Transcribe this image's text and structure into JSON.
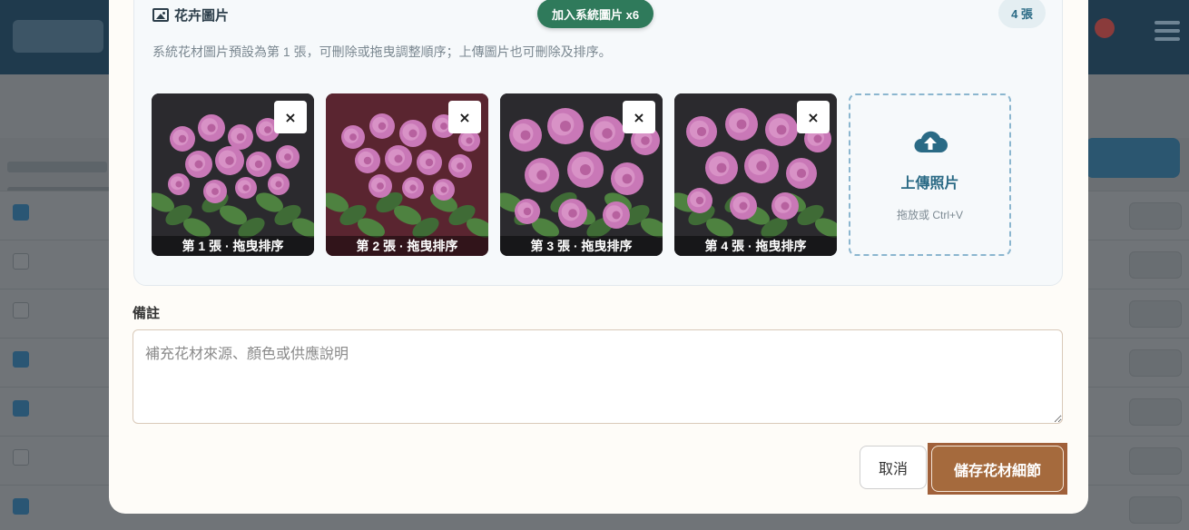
{
  "gallery": {
    "title": "花卉圖片",
    "add_system_button": "加入系統圖片 x6",
    "count_badge": "4 張",
    "hint": "系統花材圖片預設為第 1 張，可刪除或拖曳調整順序；上傳圖片也可刪除及排序。",
    "remove_label": "×",
    "images": [
      {
        "caption": "第 1 張 · 拖曳排序"
      },
      {
        "caption": "第 2 張 · 拖曳排序"
      },
      {
        "caption": "第 3 張 · 拖曳排序"
      },
      {
        "caption": "第 4 張 · 拖曳排序"
      }
    ],
    "upload": {
      "icon": "cloud-upload-icon",
      "title": "上傳照片",
      "hint": "拖放或 Ctrl+V"
    }
  },
  "note": {
    "label": "備註",
    "placeholder": "補充花材來源、顏色或供應說明",
    "value": ""
  },
  "actions": {
    "cancel": "取消",
    "save": "儲存花材細節"
  },
  "colors": {
    "primary_green": "#2f7a5b",
    "accent_blue": "#2a6a85",
    "save_brown": "#a56a3d",
    "rose_pink": "#c978b7",
    "leaf_green": "#3f6b36"
  }
}
